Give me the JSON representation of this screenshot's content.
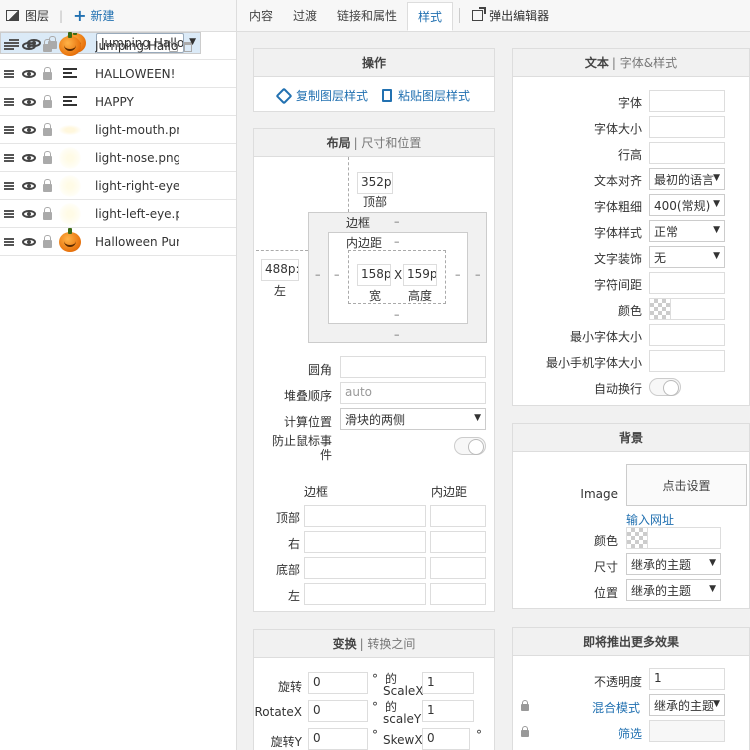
{
  "left": {
    "header_title": "图层",
    "new_label": "新建",
    "layers": [
      {
        "name": "Jumping Halloween Pumpkin",
        "thumb": "pumpkin"
      },
      {
        "name": "Jumping Hallow",
        "thumb": "pumpkin"
      },
      {
        "name": "HALLOWEEN!",
        "thumb": "text"
      },
      {
        "name": "HAPPY",
        "thumb": "text"
      },
      {
        "name": "light-mouth.pr",
        "thumb": "glow-mouth"
      },
      {
        "name": "light-nose.png",
        "thumb": "glow"
      },
      {
        "name": "light-right-eye.",
        "thumb": "glow"
      },
      {
        "name": "light-left-eye.p",
        "thumb": "glow"
      },
      {
        "name": "Halloween Pun",
        "thumb": "pumpkin"
      }
    ]
  },
  "tabs": [
    "内容",
    "过渡",
    "链接和属性",
    "样式"
  ],
  "popout_label": "弹出编辑器",
  "ops": {
    "title": "操作",
    "copy": "复制图层样式",
    "paste": "粘贴图层样式"
  },
  "layout": {
    "title": "布局",
    "subtitle": "| 尺寸和位置",
    "top_value": "352p",
    "top_label": "顶部",
    "left_value": "488p:",
    "left_label": "左",
    "border_label": "边框",
    "padding_label": "内边距",
    "dash": "–",
    "width_value": "158p",
    "height_value": "159p",
    "x": "X",
    "width_label": "宽",
    "height_label": "高度",
    "radius_label": "圆角",
    "zindex_label": "堆叠顺序",
    "zindex_placeholder": "auto",
    "calc_label": "计算位置",
    "calc_value": "滑块的两侧",
    "prevent_label_1": "防止鼠标事",
    "prevent_label_2": "件",
    "col_border": "边框",
    "col_padding": "内边距",
    "rows": [
      "顶部",
      "右",
      "底部",
      "左"
    ]
  },
  "transform": {
    "title": "变换",
    "subtitle": "| 转换之间",
    "rotate_label": "旋转",
    "rotate_value": "0",
    "deg": "°",
    "scalex_label_1": "的",
    "scalex_label_2": "ScaleX",
    "scalex_value": "1",
    "rotatex_label": "RotateX",
    "rotatex_value": "0",
    "scaley_label_1": "的",
    "scaley_label_2": "scaleY",
    "scaley_value": "1",
    "rotatey_label": "旋转Y",
    "rotatey_value": "0",
    "skewx_label": "SkewX",
    "skewx_value": "0"
  },
  "text": {
    "title": "文本",
    "subtitle": "| 字体&样式",
    "font_label": "字体",
    "size_label": "字体大小",
    "line_label": "行高",
    "align_label": "文本对齐",
    "align_value": "最初的语言",
    "weight_label": "字体粗细",
    "weight_value": "400(常规)",
    "style_label": "字体样式",
    "style_value": "正常",
    "deco_label": "文字装饰",
    "deco_value": "无",
    "spacing_label": "字符间距",
    "color_label": "颜色",
    "min_label": "最小字体大小",
    "min_mobile_label": "最小手机字体大小",
    "wrap_label": "自动换行"
  },
  "bg": {
    "title": "背景",
    "image_label": "Image",
    "set_label": "点击设置",
    "url_label": "输入网址",
    "color_label": "颜色",
    "size_label": "尺寸",
    "size_value": "继承的主题",
    "pos_label": "位置",
    "pos_value": "继承的主题"
  },
  "more": {
    "title": "即将推出更多效果",
    "opacity_label": "不透明度",
    "opacity_value": "1",
    "blend_label": "混合模式",
    "blend_value": "继承的主题",
    "filter_label": "筛选"
  },
  "colors": {
    "accent": "#2271b1",
    "selected_row": "#dbeaf7"
  }
}
